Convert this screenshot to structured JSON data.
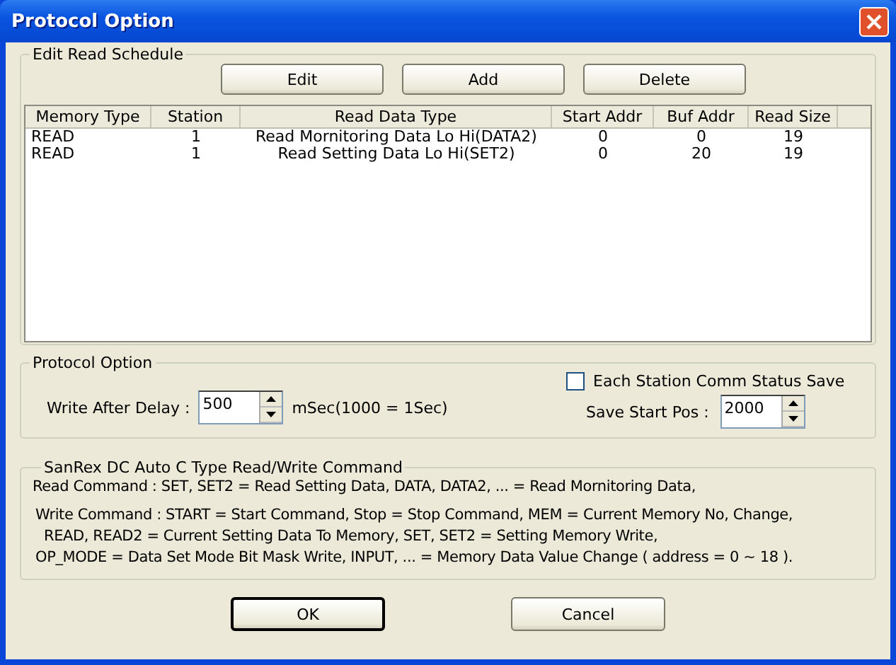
{
  "window": {
    "title": "Protocol Option"
  },
  "schedule": {
    "title": "Edit Read Schedule",
    "buttons": [
      "Edit",
      "Add",
      "Delete"
    ],
    "columns": [
      "Memory Type",
      "Station",
      "Read Data Type",
      "Start Addr",
      "Buf Addr",
      "Read Size"
    ],
    "rows": [
      [
        "READ",
        "1",
        "Read Mornitoring Data Lo Hi(DATA2)",
        "0",
        "0",
        "19"
      ],
      [
        "READ",
        "1",
        "Read Setting Data Lo Hi(SET2)",
        "0",
        "20",
        "19"
      ]
    ]
  },
  "protocol_option": {
    "title": "Protocol Option",
    "write_after_delay": {
      "label": "Write After Delay :",
      "value": "500",
      "unit": "mSec(1000 = 1Sec)"
    },
    "status_save": {
      "label": "Each Station Comm Status Save",
      "checked": false
    },
    "save_start_pos": {
      "label": "Save Start Pos :",
      "value": "2000"
    }
  },
  "command_help": {
    "title": "SanRex DC Auto C Type Read/Write Command",
    "lines": [
      "Read Command : SET, SET2 = Read Setting Data,  DATA, DATA2, ... = Read Mornitoring Data,",
      "Write Command : START = Start Command, Stop = Stop Command, MEM = Current Memory No, Change,",
      "READ, READ2 = Current Setting Data To Memory, SET, SET2 = Setting Memory Write,",
      "OP_MODE = Data Set Mode Bit Mask Write, INPUT, ... = Memory Data Value Change ( address = 0 ~ 18 )."
    ]
  },
  "buttons": [
    {
      "label": "OK",
      "default": true
    },
    {
      "label": "Cancel",
      "default": false
    }
  ]
}
